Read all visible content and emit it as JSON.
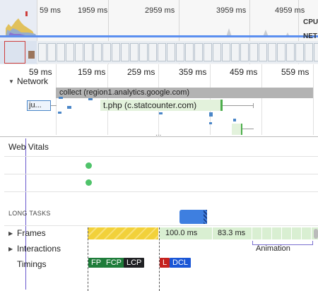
{
  "overview": {
    "time_labels": [
      "59 ms",
      "1959 ms",
      "2959 ms",
      "3959 ms",
      "4959 ms"
    ],
    "cpu_label": "CPU",
    "net_label": "NET"
  },
  "ruler": {
    "ticks": [
      "59 ms",
      "159 ms",
      "259 ms",
      "359 ms",
      "459 ms",
      "559 ms"
    ]
  },
  "network": {
    "section_label": "Network",
    "requests": [
      {
        "label": "collect (region1.analytics.google.com)"
      },
      {
        "label": "ju..."
      },
      {
        "label": "t.php (c.statcounter.com)"
      }
    ]
  },
  "divider_label": "...",
  "web_vitals": {
    "label": "Web Vitals",
    "long_tasks_label": "LONG TASKS"
  },
  "tracks": {
    "frames_label": "Frames",
    "frames_durations": [
      "100.0 ms",
      "83.3 ms"
    ],
    "interactions_label": "Interactions",
    "interactions_animation": "Animation",
    "timings_label": "Timings",
    "markers": [
      "FP",
      "FCP",
      "LCP",
      "L",
      "DCL"
    ]
  },
  "colors": {
    "network_gray": "#b3b3b3",
    "request_blue": "#4a86c8",
    "request_green": "#8bc67d",
    "long_task_blue": "#3e7fe0",
    "vital_green": "#4fc36a",
    "marker_green": "#1e7c3a",
    "marker_black": "#202124",
    "marker_red": "#c5221f",
    "marker_blue": "#1a56d6",
    "frames_green": "#d9efd2",
    "frames_yellow": "#f2d13a",
    "cursor_purple": "#6a5acd",
    "animation_purple": "#7a6fd0"
  }
}
